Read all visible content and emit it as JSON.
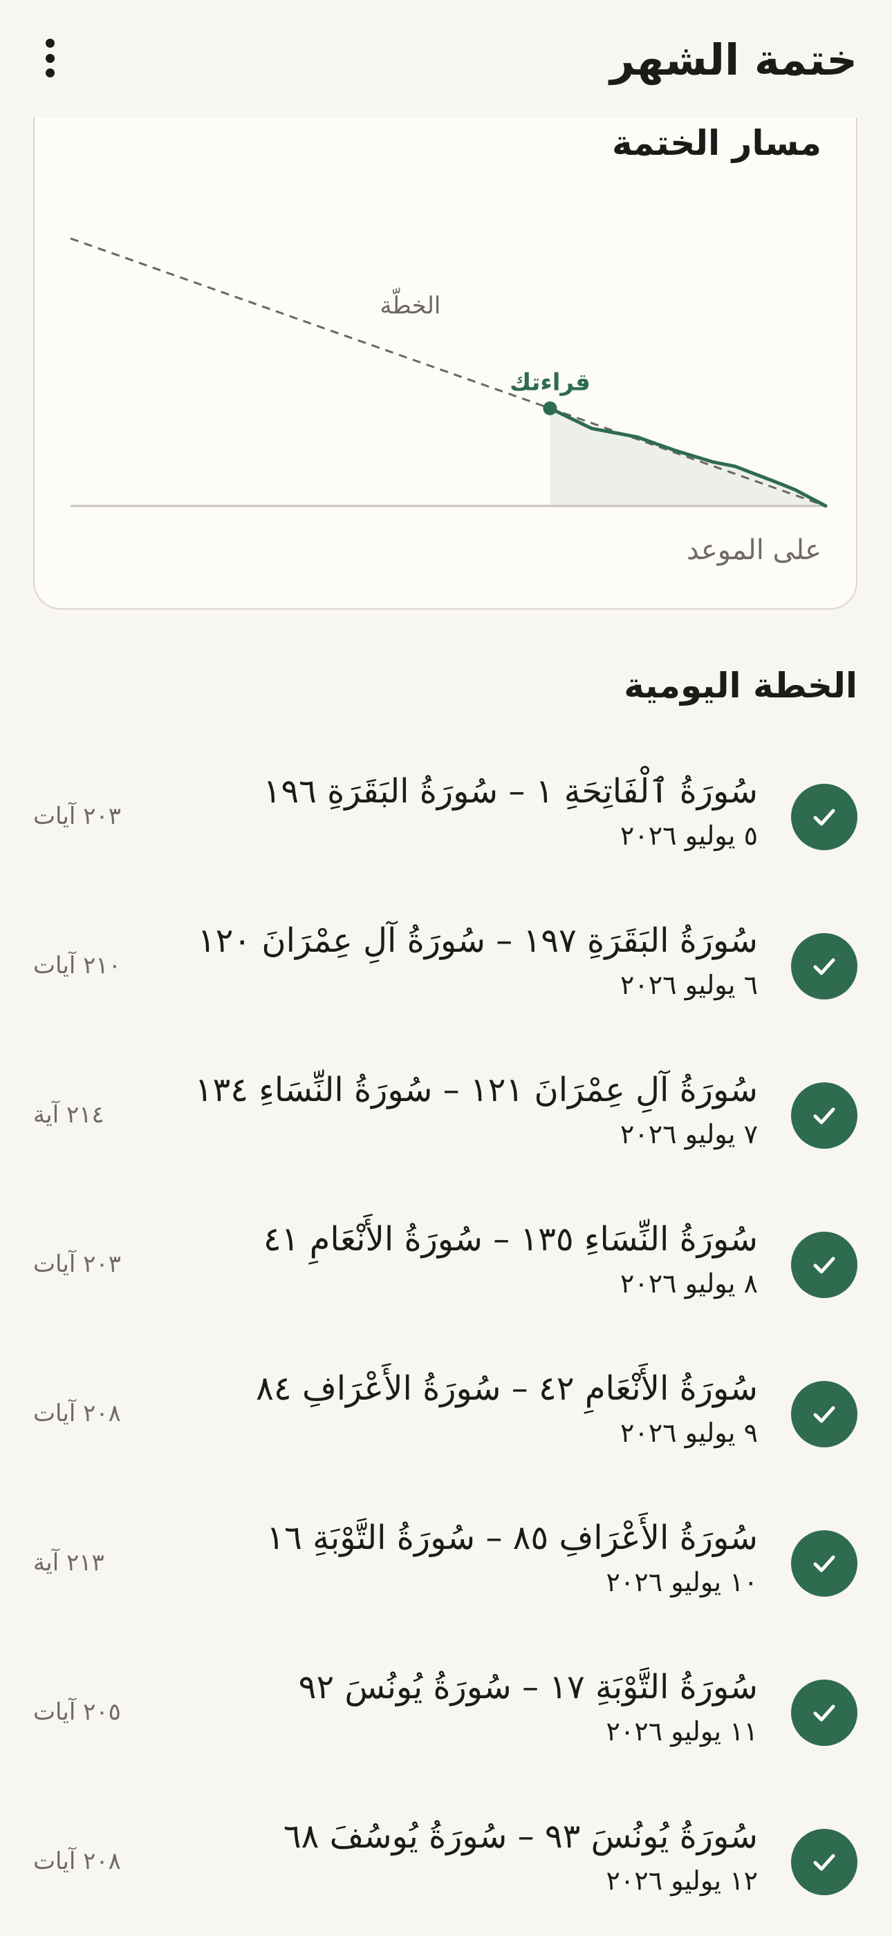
{
  "app": {
    "title": "ختمة الشهر",
    "menu_icon": "more-vert-icon"
  },
  "chart_card": {
    "title": "مسار الختمة",
    "status": "على الموعد",
    "colors": {
      "plan_line": "#6b6760",
      "progress_line": "#2f6b4f",
      "progress_fill": "#edf0ea",
      "axis": "#c9c3b8"
    }
  },
  "chart_data": {
    "type": "line",
    "series": [
      {
        "name": "الخطّة",
        "x": [
          0,
          1
        ],
        "y": [
          1,
          0
        ],
        "style": "dashed"
      },
      {
        "name": "قراءتك",
        "x": [
          0.635,
          0.69,
          0.75,
          0.8,
          0.85,
          0.88,
          0.93,
          0.96,
          1.0
        ],
        "y": [
          0.365,
          0.29,
          0.258,
          0.208,
          0.165,
          0.148,
          0.094,
          0.06,
          0.0
        ]
      }
    ],
    "current_point": {
      "x": 0.635,
      "y": 0.365
    },
    "xlim": [
      0,
      1
    ],
    "ylim": [
      0,
      1
    ],
    "grid": false,
    "legend": "inline labels"
  },
  "daily_plan": {
    "title": "الخطة اليومية",
    "check_icon": "check-icon",
    "items": [
      {
        "range": "سُورَةُ ٱلْفَاتِحَةِ ١ – سُورَةُ البَقَرَةِ ١٩٦",
        "date": "٥ يوليو ٢٠٢٦",
        "count": "٢٠٣ آيات",
        "completed": true
      },
      {
        "range": "سُورَةُ البَقَرَةِ ١٩٧ – سُورَةُ آلِ عِمْرَانَ ١٢٠",
        "date": "٦ يوليو ٢٠٢٦",
        "count": "٢١٠ آيات",
        "completed": true
      },
      {
        "range": "سُورَةُ آلِ عِمْرَانَ ١٢١ – سُورَةُ النِّسَاءِ ١٣٤",
        "date": "٧ يوليو ٢٠٢٦",
        "count": "٢١٤ آية",
        "completed": true
      },
      {
        "range": "سُورَةُ النِّسَاءِ ١٣٥ – سُورَةُ الأَنْعَامِ ٤١",
        "date": "٨ يوليو ٢٠٢٦",
        "count": "٢٠٣ آيات",
        "completed": true
      },
      {
        "range": "سُورَةُ الأَنْعَامِ ٤٢ – سُورَةُ الأَعْرَافِ ٨٤",
        "date": "٩ يوليو ٢٠٢٦",
        "count": "٢٠٨ آيات",
        "completed": true
      },
      {
        "range": "سُورَةُ الأَعْرَافِ ٨٥ – سُورَةُ التَّوْبَةِ ١٦",
        "date": "١٠ يوليو ٢٠٢٦",
        "count": "٢١٣ آية",
        "completed": true
      },
      {
        "range": "سُورَةُ التَّوْبَةِ ١٧ – سُورَةُ يُونُسَ ٩٢",
        "date": "١١ يوليو ٢٠٢٦",
        "count": "٢٠٥ آيات",
        "completed": true
      },
      {
        "range": "سُورَةُ يُونُسَ ٩٣ – سُورَةُ يُوسُفَ ٦٨",
        "date": "١٢ يوليو ٢٠٢٦",
        "count": "٢٠٨ آيات",
        "completed": true
      }
    ]
  }
}
